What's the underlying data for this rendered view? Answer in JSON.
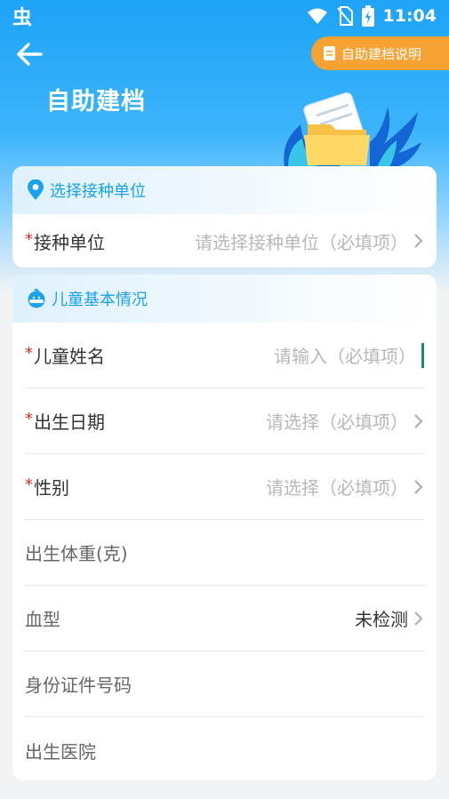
{
  "status_bar": {
    "app_icon": "虫",
    "time": "11:04"
  },
  "header": {
    "back_icon": "arrow-left-icon",
    "guide_button_label": "自助建档说明",
    "title": "自助建档"
  },
  "colors": {
    "primary": "#1ea3f7",
    "accent_orange": "#f6a334",
    "required_red": "#e52a2a",
    "card_heading": "#1aa2ec"
  },
  "sections": {
    "unit": {
      "heading": "选择接种单位",
      "icon": "location-pin-icon",
      "row": {
        "required_mark": "*",
        "label": "接种单位",
        "placeholder": "请选择接种单位（必填项）"
      }
    },
    "child": {
      "heading": "儿童基本情况",
      "icon": "child-face-icon",
      "name": {
        "required_mark": "*",
        "label": "儿童姓名",
        "placeholder": "请输入（必填项）"
      },
      "birth": {
        "required_mark": "*",
        "label": "出生日期",
        "placeholder": "请选择（必填项）"
      },
      "gender": {
        "required_mark": "*",
        "label": "性别",
        "placeholder": "请选择（必填项）"
      },
      "weight": {
        "label": "出生体重(克)"
      },
      "blood": {
        "label": "血型",
        "value": "未检测"
      },
      "id": {
        "label": "身份证件号码"
      },
      "hospital": {
        "label": "出生医院"
      }
    }
  }
}
